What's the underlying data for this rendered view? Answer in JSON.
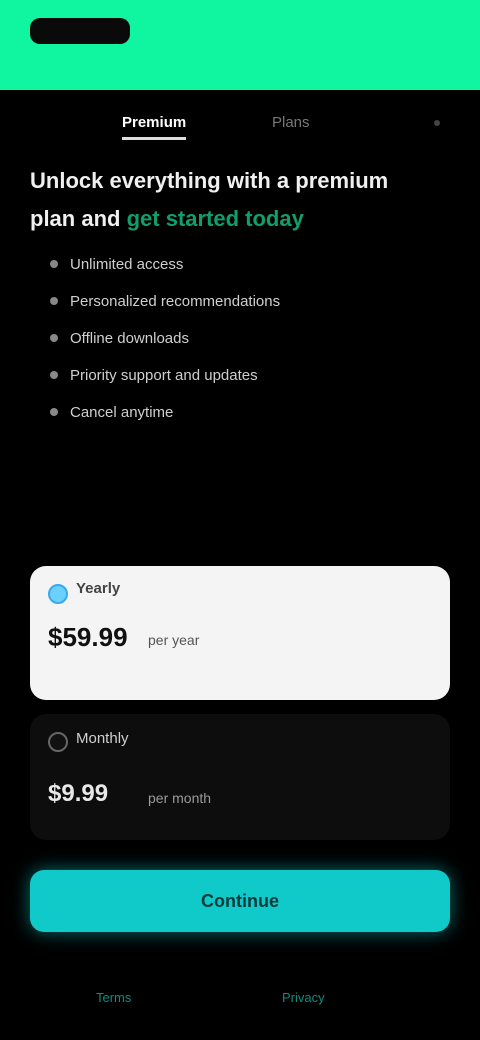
{
  "header": {
    "logo_label": "",
    "top_link": ""
  },
  "tabs": [
    {
      "label": "Premium"
    },
    {
      "label": "Plans"
    }
  ],
  "headline": {
    "main": "Unlock everything with a premium plan and",
    "accent": "get started today"
  },
  "features": [
    {
      "label": "Unlimited access"
    },
    {
      "label": "Personalized recommendations"
    },
    {
      "label": "Offline downloads"
    },
    {
      "label": "Priority support and updates"
    },
    {
      "label": "Cancel anytime"
    }
  ],
  "plans": [
    {
      "name": "Yearly",
      "price": "$59.99",
      "price_note": "per year",
      "sub_note": ""
    },
    {
      "name": "Monthly",
      "price": "$9.99",
      "price_note": "per month"
    }
  ],
  "cta": {
    "label": "Continue"
  },
  "footer": {
    "note": "",
    "links": [
      {
        "label": "Terms"
      },
      {
        "label": "Privacy"
      }
    ]
  },
  "colors": {
    "topbar": "#10f59f",
    "accent_text": "#0f9f6f",
    "cta": "#10c9c9",
    "background": "#000000"
  }
}
